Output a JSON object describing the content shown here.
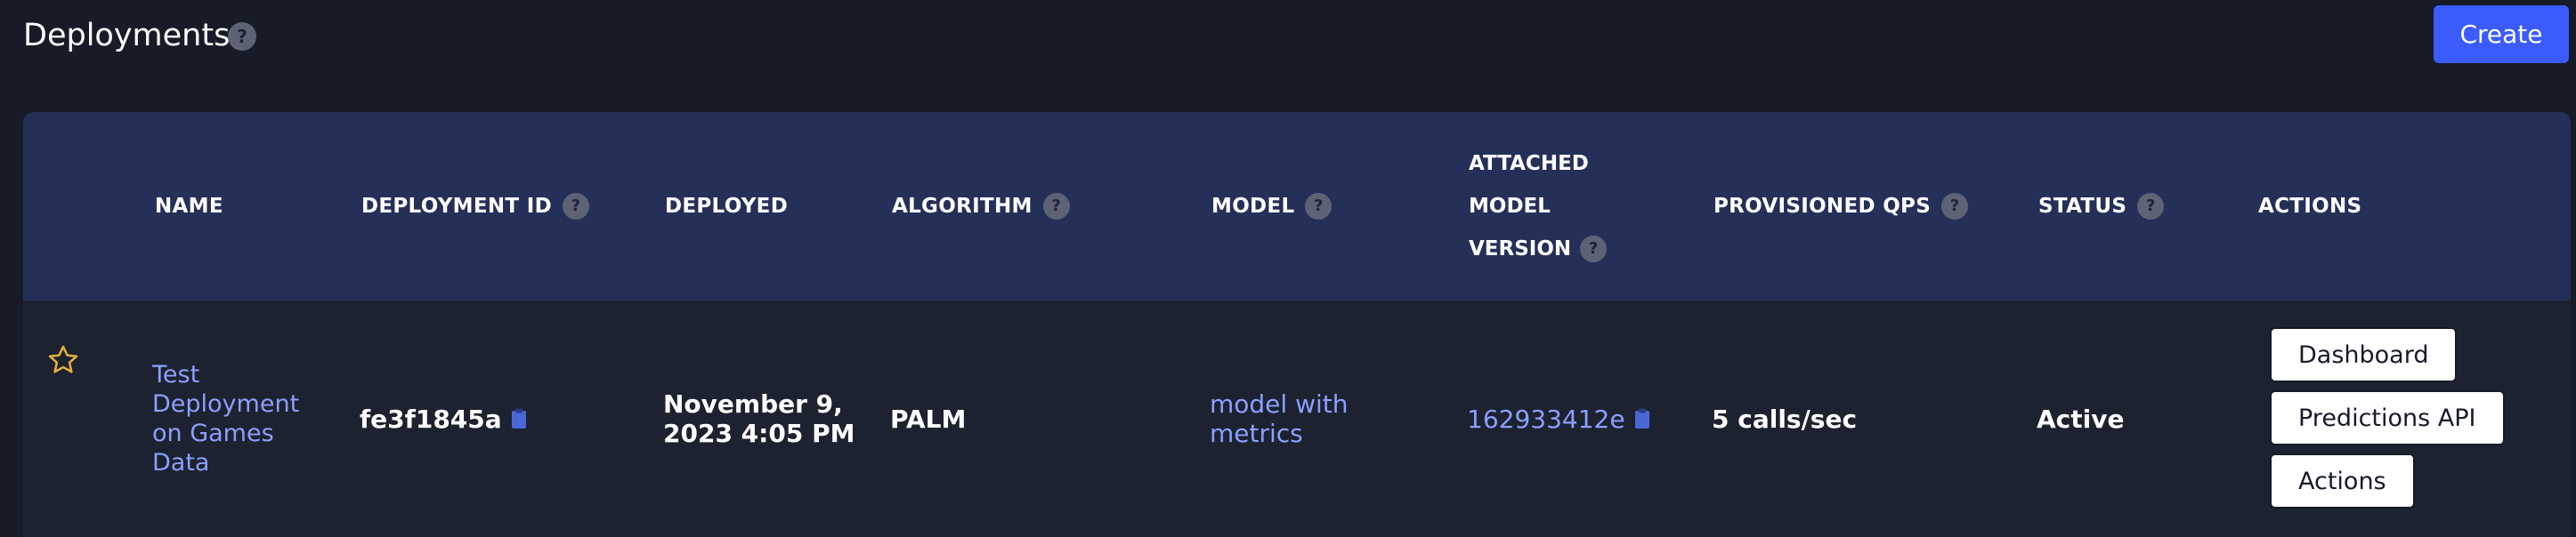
{
  "header": {
    "title": "Deployments",
    "help": "?",
    "create_label": "Create"
  },
  "colors": {
    "background": "#161b27",
    "header_row": "#253059",
    "body_row": "#1d2230",
    "primary_button": "#3b5bfd",
    "link": "#8aa0ff",
    "star": "#e3b23c",
    "copy_icon": "#4a67d6"
  },
  "table": {
    "columns": {
      "name": "NAME",
      "deployment_id": "DEPLOYMENT ID",
      "deployed": "DEPLOYED",
      "algorithm": "ALGORITHM",
      "model": "MODEL",
      "attached_line1": "ATTACHED",
      "attached_line2": "MODEL",
      "attached_line3": "VERSION",
      "provisioned_qps": "PROVISIONED QPS",
      "status": "STATUS",
      "actions": "ACTIONS"
    },
    "help": "?",
    "rows": [
      {
        "starred": false,
        "name_lines": [
          "Test",
          "Deployment",
          "on Games",
          "Data"
        ],
        "deployment_id": "fe3f1845a",
        "deployed_line1": "November 9,",
        "deployed_line2": "2023 4:05 PM",
        "algorithm": "PALM",
        "model_line1": "model with",
        "model_line2": "metrics",
        "attached_version": "162933412e",
        "provisioned_qps": "5 calls/sec",
        "status": "Active",
        "actions": {
          "dashboard": "Dashboard",
          "predictions_api": "Predictions API",
          "actions": "Actions"
        }
      }
    ]
  },
  "icons": {
    "help": "help-icon",
    "copy": "clipboard-icon",
    "star": "star-outline-icon"
  }
}
